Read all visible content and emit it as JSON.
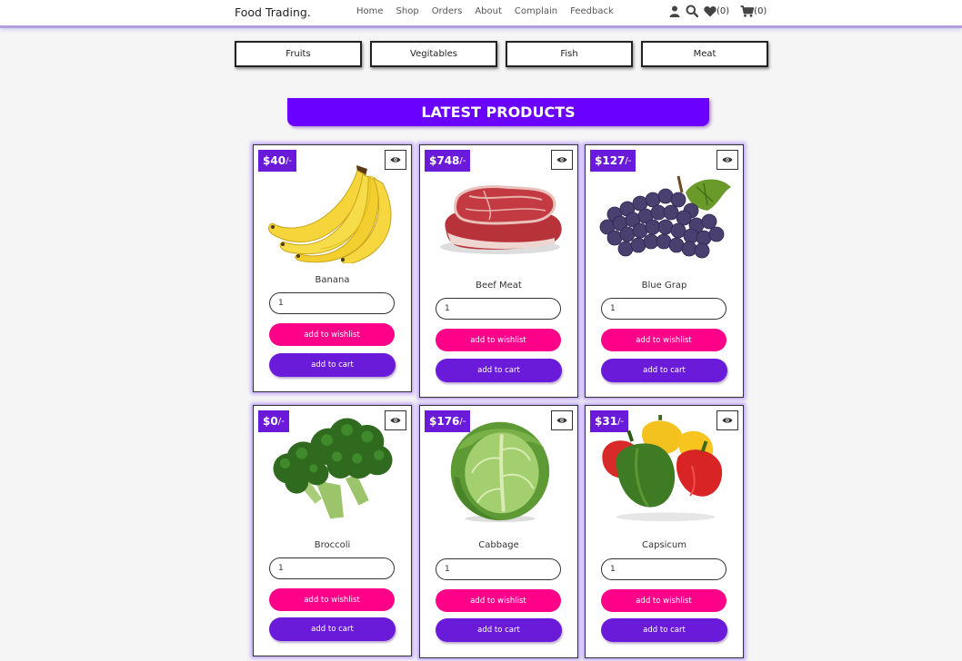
{
  "header": {
    "logo": "Food Trading.",
    "nav": [
      "Home",
      "Shop",
      "Orders",
      "About",
      "Complain",
      "Feedback"
    ],
    "wishlist_count": "(0)",
    "cart_count": "(0)"
  },
  "categories": [
    "Fruits",
    "Vegitables",
    "Fish",
    "Meat"
  ],
  "section_title": "LATEST PRODUCTS",
  "products": [
    {
      "price": "$40",
      "suffix": "/-",
      "name": "Banana",
      "qty": "1",
      "wish": "add to wishlist",
      "cart": "add to cart",
      "image": "banana-image"
    },
    {
      "price": "$748",
      "suffix": "/-",
      "name": "Beef Meat",
      "qty": "1",
      "wish": "add to wishlist",
      "cart": "add to cart",
      "image": "beef-image"
    },
    {
      "price": "$127",
      "suffix": "/-",
      "name": "Blue Grap",
      "qty": "1",
      "wish": "add to wishlist",
      "cart": "add to cart",
      "image": "grapes-image"
    },
    {
      "price": "$0",
      "suffix": "/-",
      "name": "Broccoli",
      "qty": "1",
      "wish": "add to wishlist",
      "cart": "add to cart",
      "image": "broccoli-image"
    },
    {
      "price": "$176",
      "suffix": "/-",
      "name": "Cabbage",
      "qty": "1",
      "wish": "add to wishlist",
      "cart": "add to cart",
      "image": "cabbage-image"
    },
    {
      "price": "$31",
      "suffix": "/-",
      "name": "Capsicum",
      "qty": "1",
      "wish": "add to wishlist",
      "cart": "add to cart",
      "image": "capsicum-image"
    }
  ],
  "colors": {
    "accent": "#6a00ff",
    "wishlist": "#ff0088",
    "cart": "#6a1bd9"
  }
}
